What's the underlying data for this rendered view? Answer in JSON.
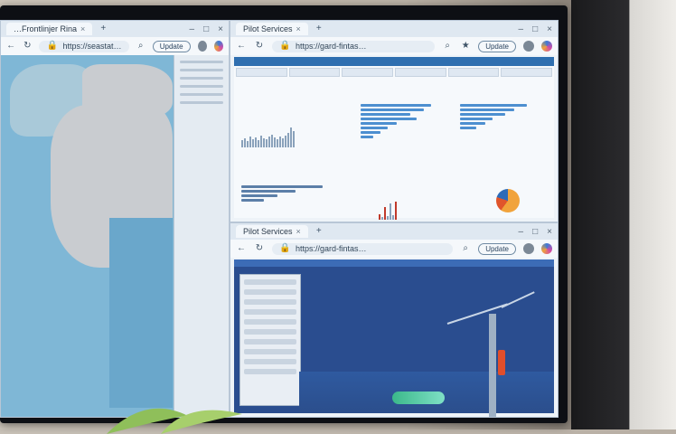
{
  "windows": {
    "left": {
      "tab_title": "…Frontlinjer Rina",
      "url": "https://seastat…",
      "update_label": "Update"
    },
    "top_right": {
      "tab_title": "Pilot Services",
      "url": "https://gard-fintas…",
      "update_label": "Update"
    },
    "bottom_right": {
      "tab_title": "Pilot Services",
      "url": "https://gard-fintas…",
      "update_label": "Update"
    }
  },
  "colors": {
    "accent": "#2f6fb0",
    "sea": "#7fb7d6",
    "scene_bg": "#2a4d8f"
  },
  "icons": [
    "plus-icon",
    "close-icon",
    "back-icon",
    "refresh-icon",
    "lock-icon",
    "search-icon",
    "star-icon",
    "profile-icon",
    "copilot-icon",
    "minimize-icon",
    "maximize-icon"
  ]
}
